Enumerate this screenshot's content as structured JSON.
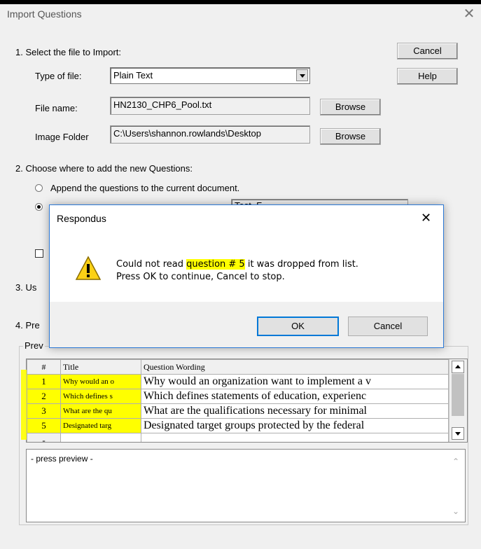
{
  "window": {
    "title": "Import Questions",
    "close_glyph": "✕"
  },
  "step1": {
    "heading": "1. Select the file to Import:",
    "type_label": "Type of file:",
    "type_value": "Plain Text",
    "file_label": "File name:",
    "file_value": "HN2130_CHP6_Pool.txt",
    "image_label": "Image Folder",
    "image_value": "C:\\Users\\shannon.rowlands\\Desktop",
    "browse_label": "Browse"
  },
  "buttons": {
    "cancel": "Cancel",
    "help": "Help"
  },
  "step2": {
    "heading": "2. Choose where to add the new Questions:",
    "append_label": "Append the questions to the current document.",
    "new_doc_field": "Test_F..."
  },
  "step3": {
    "heading_partial": "3. Us"
  },
  "step4": {
    "heading_partial": "4. Pre",
    "group_label_partial": "Prev"
  },
  "preview_table": {
    "headers": [
      "#",
      "Title",
      "Question Wording"
    ],
    "rows": [
      {
        "num": "1",
        "title": "Why would an o",
        "wording": "Why would an organization want to implement a v"
      },
      {
        "num": "2",
        "title": "Which defines s",
        "wording": "Which defines statements of education, experienc"
      },
      {
        "num": "3",
        "title": "What are the qu",
        "wording": "What are the qualifications necessary for minimal"
      },
      {
        "num": "5",
        "title": "Designated targ",
        "wording": "Designated target groups protected by the federal"
      },
      {
        "num": "-",
        "title": "",
        "wording": ""
      }
    ]
  },
  "preview_text": "- press preview -",
  "dialog": {
    "title": "Respondus",
    "close_glyph": "✕",
    "msg_pre": "Could not read ",
    "msg_highlight": "question # 5",
    "msg_post": " it was dropped from list.",
    "msg_line2": "Press OK to continue, Cancel to stop.",
    "ok_label": "OK",
    "cancel_label": "Cancel"
  },
  "colors": {
    "highlight": "#ffff00",
    "dialog_border": "#2b78d6"
  }
}
